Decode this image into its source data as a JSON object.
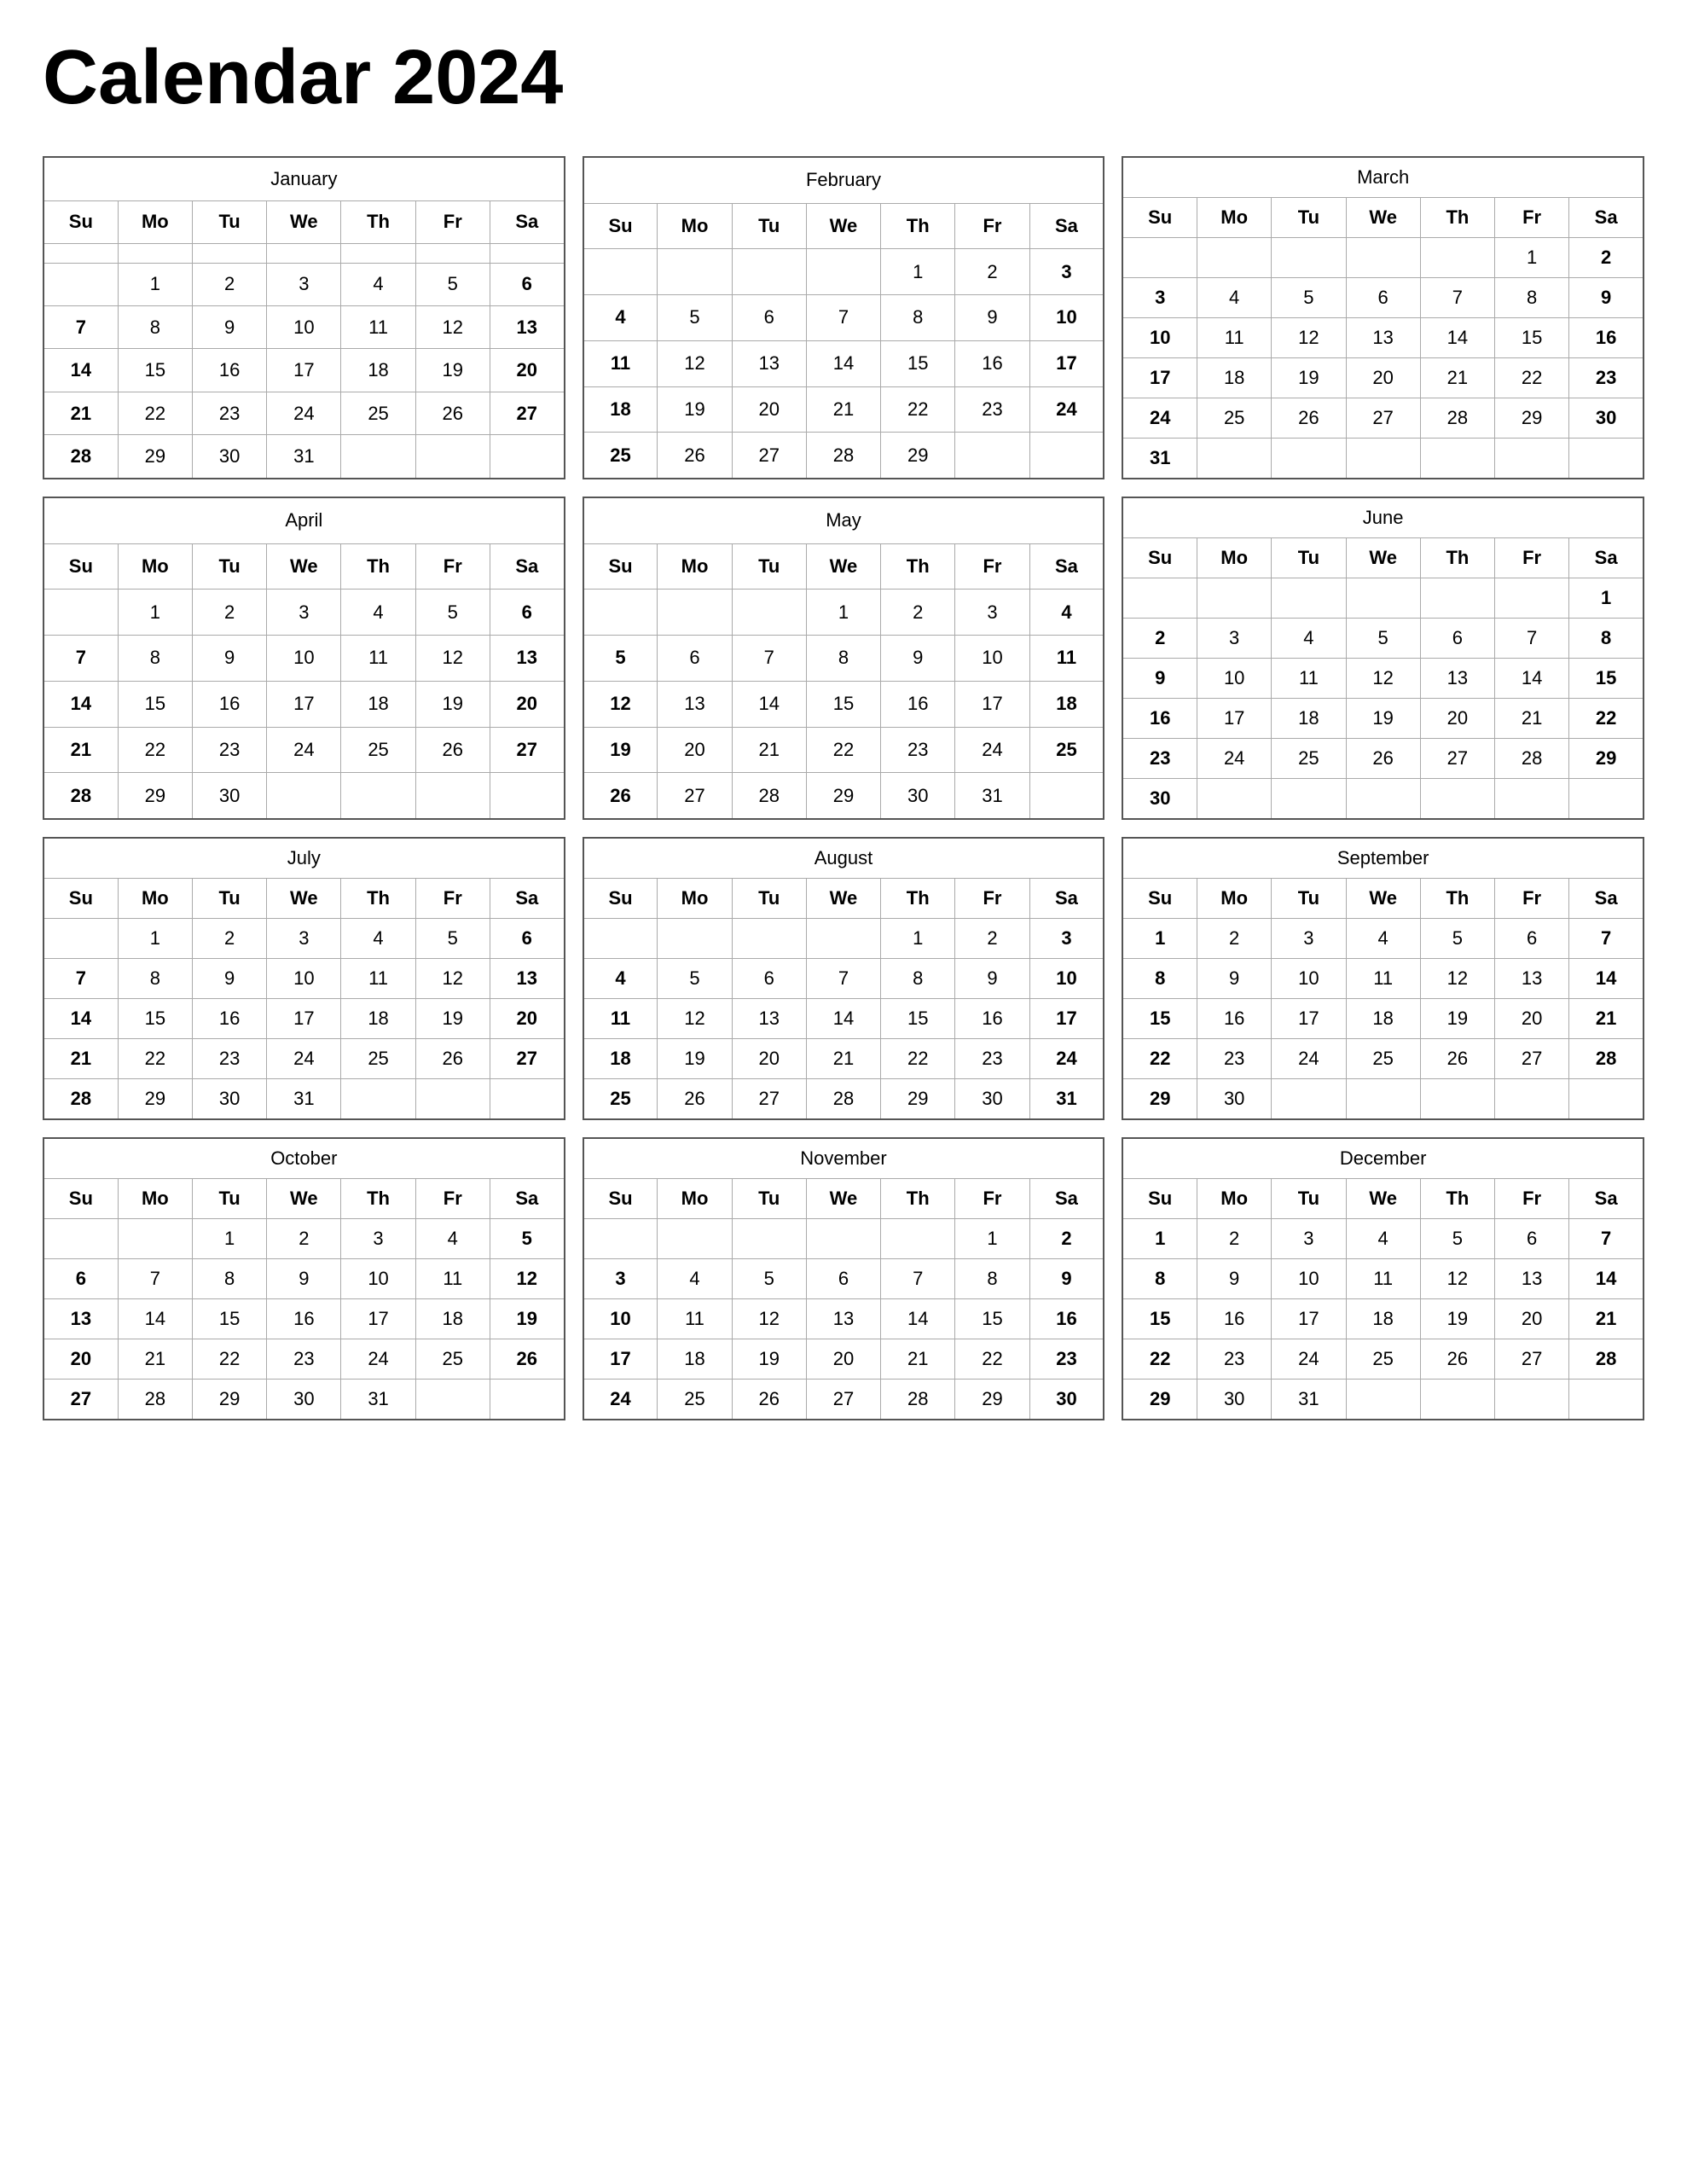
{
  "title": "Calendar 2024",
  "months": [
    {
      "name": "January",
      "days_header": [
        "Su",
        "Mo",
        "Tu",
        "We",
        "Th",
        "Fr",
        "Sa"
      ],
      "weeks": [
        [
          "",
          "",
          "",
          "",
          "",
          "",
          ""
        ],
        [
          "",
          "1",
          "2",
          "3",
          "4",
          "5",
          "6"
        ],
        [
          "7",
          "8",
          "9",
          "10",
          "11",
          "12",
          "13"
        ],
        [
          "14",
          "15",
          "16",
          "17",
          "18",
          "19",
          "20"
        ],
        [
          "21",
          "22",
          "23",
          "24",
          "25",
          "26",
          "27"
        ],
        [
          "28",
          "29",
          "30",
          "31",
          "",
          "",
          ""
        ]
      ],
      "sat_bold": [
        6,
        13,
        20,
        27
      ],
      "sun_bold": [
        7,
        14,
        21,
        28
      ]
    },
    {
      "name": "February",
      "weeks": [
        [
          "",
          "",
          "",
          "",
          "1",
          "2",
          "3"
        ],
        [
          "4",
          "5",
          "6",
          "7",
          "8",
          "9",
          "10"
        ],
        [
          "11",
          "12",
          "13",
          "14",
          "15",
          "16",
          "17"
        ],
        [
          "18",
          "19",
          "20",
          "21",
          "22",
          "23",
          "24"
        ],
        [
          "25",
          "26",
          "27",
          "28",
          "29",
          "",
          ""
        ]
      ]
    },
    {
      "name": "March",
      "weeks": [
        [
          "",
          "",
          "",
          "",
          "",
          "1",
          "2"
        ],
        [
          "3",
          "4",
          "5",
          "6",
          "7",
          "8",
          "9"
        ],
        [
          "10",
          "11",
          "12",
          "13",
          "14",
          "15",
          "16"
        ],
        [
          "17",
          "18",
          "19",
          "20",
          "21",
          "22",
          "23"
        ],
        [
          "24",
          "25",
          "26",
          "27",
          "28",
          "29",
          "30"
        ],
        [
          "31",
          "",
          "",
          "",
          "",
          "",
          ""
        ]
      ]
    },
    {
      "name": "April",
      "weeks": [
        [
          "",
          "1",
          "2",
          "3",
          "4",
          "5",
          "6"
        ],
        [
          "7",
          "8",
          "9",
          "10",
          "11",
          "12",
          "13"
        ],
        [
          "14",
          "15",
          "16",
          "17",
          "18",
          "19",
          "20"
        ],
        [
          "21",
          "22",
          "23",
          "24",
          "25",
          "26",
          "27"
        ],
        [
          "28",
          "29",
          "30",
          "",
          "",
          "",
          ""
        ]
      ]
    },
    {
      "name": "May",
      "weeks": [
        [
          "",
          "",
          "",
          "1",
          "2",
          "3",
          "4"
        ],
        [
          "5",
          "6",
          "7",
          "8",
          "9",
          "10",
          "11"
        ],
        [
          "12",
          "13",
          "14",
          "15",
          "16",
          "17",
          "18"
        ],
        [
          "19",
          "20",
          "21",
          "22",
          "23",
          "24",
          "25"
        ],
        [
          "26",
          "27",
          "28",
          "29",
          "30",
          "31",
          ""
        ]
      ]
    },
    {
      "name": "June",
      "weeks": [
        [
          "",
          "",
          "",
          "",
          "",
          "",
          "1"
        ],
        [
          "2",
          "3",
          "4",
          "5",
          "6",
          "7",
          "8"
        ],
        [
          "9",
          "10",
          "11",
          "12",
          "13",
          "14",
          "15"
        ],
        [
          "16",
          "17",
          "18",
          "19",
          "20",
          "21",
          "22"
        ],
        [
          "23",
          "24",
          "25",
          "26",
          "27",
          "28",
          "29"
        ],
        [
          "30",
          "",
          "",
          "",
          "",
          "",
          ""
        ]
      ]
    },
    {
      "name": "July",
      "weeks": [
        [
          "",
          "1",
          "2",
          "3",
          "4",
          "5",
          "6"
        ],
        [
          "7",
          "8",
          "9",
          "10",
          "11",
          "12",
          "13"
        ],
        [
          "14",
          "15",
          "16",
          "17",
          "18",
          "19",
          "20"
        ],
        [
          "21",
          "22",
          "23",
          "24",
          "25",
          "26",
          "27"
        ],
        [
          "28",
          "29",
          "30",
          "31",
          "",
          "",
          ""
        ]
      ]
    },
    {
      "name": "August",
      "weeks": [
        [
          "",
          "",
          "",
          "",
          "1",
          "2",
          "3"
        ],
        [
          "4",
          "5",
          "6",
          "7",
          "8",
          "9",
          "10"
        ],
        [
          "11",
          "12",
          "13",
          "14",
          "15",
          "16",
          "17"
        ],
        [
          "18",
          "19",
          "20",
          "21",
          "22",
          "23",
          "24"
        ],
        [
          "25",
          "26",
          "27",
          "28",
          "29",
          "30",
          "31"
        ]
      ]
    },
    {
      "name": "September",
      "weeks": [
        [
          "1",
          "2",
          "3",
          "4",
          "5",
          "6",
          "7"
        ],
        [
          "8",
          "9",
          "10",
          "11",
          "12",
          "13",
          "14"
        ],
        [
          "15",
          "16",
          "17",
          "18",
          "19",
          "20",
          "21"
        ],
        [
          "22",
          "23",
          "24",
          "25",
          "26",
          "27",
          "28"
        ],
        [
          "29",
          "30",
          "",
          "",
          "",
          "",
          ""
        ]
      ]
    },
    {
      "name": "October",
      "weeks": [
        [
          "",
          "",
          "1",
          "2",
          "3",
          "4",
          "5"
        ],
        [
          "6",
          "7",
          "8",
          "9",
          "10",
          "11",
          "12"
        ],
        [
          "13",
          "14",
          "15",
          "16",
          "17",
          "18",
          "19"
        ],
        [
          "20",
          "21",
          "22",
          "23",
          "24",
          "25",
          "26"
        ],
        [
          "27",
          "28",
          "29",
          "30",
          "31",
          "",
          ""
        ]
      ]
    },
    {
      "name": "November",
      "weeks": [
        [
          "",
          "",
          "",
          "",
          "",
          "1",
          "2"
        ],
        [
          "3",
          "4",
          "5",
          "6",
          "7",
          "8",
          "9"
        ],
        [
          "10",
          "11",
          "12",
          "13",
          "14",
          "15",
          "16"
        ],
        [
          "17",
          "18",
          "19",
          "20",
          "21",
          "22",
          "23"
        ],
        [
          "24",
          "25",
          "26",
          "27",
          "28",
          "29",
          "30"
        ]
      ]
    },
    {
      "name": "December",
      "weeks": [
        [
          "1",
          "2",
          "3",
          "4",
          "5",
          "6",
          "7"
        ],
        [
          "8",
          "9",
          "10",
          "11",
          "12",
          "13",
          "14"
        ],
        [
          "15",
          "16",
          "17",
          "18",
          "19",
          "20",
          "21"
        ],
        [
          "22",
          "23",
          "24",
          "25",
          "26",
          "27",
          "28"
        ],
        [
          "29",
          "30",
          "31",
          "",
          "",
          "",
          ""
        ]
      ]
    }
  ],
  "days_header": [
    "Su",
    "Mo",
    "Tu",
    "We",
    "Th",
    "Fr",
    "Sa"
  ]
}
